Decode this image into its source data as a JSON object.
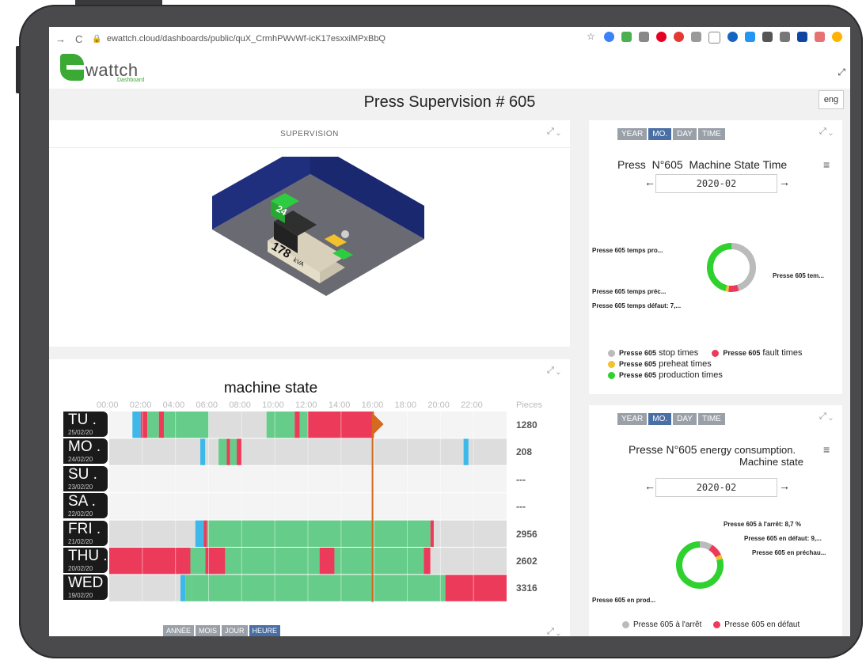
{
  "browser": {
    "url": "ewattch.cloud/dashboards/public/quX_CrmhPWvWf-icK17esxxiMPxBbQ"
  },
  "app": {
    "logo_text": "wattch",
    "logo_sub": "Dashboard",
    "page_title": "Press Supervision # 605",
    "lang": "eng"
  },
  "supervision": {
    "header": "SUPERVISION",
    "machine_number": "24",
    "machine_power": "178",
    "machine_unit": "kVA"
  },
  "machine_state": {
    "title": "machine state",
    "hours": [
      "00:00",
      "02:00",
      "04:00",
      "06:00",
      "08:00",
      "10:00",
      "12:00",
      "14:00",
      "16:00",
      "18:00",
      "20:00",
      "22:00"
    ],
    "pieces_header": "Pieces",
    "days": [
      {
        "day": "TU",
        "date": "25/02/20",
        "pieces": "1280"
      },
      {
        "day": "MO",
        "date": "24/02/20",
        "pieces": "208"
      },
      {
        "day": "SU",
        "date": "23/02/20",
        "pieces": "---"
      },
      {
        "day": "SA",
        "date": "22/02/20",
        "pieces": "---"
      },
      {
        "day": "FRI",
        "date": "21/02/20",
        "pieces": "2956"
      },
      {
        "day": "THU",
        "date": "20/02/20",
        "pieces": "2602"
      },
      {
        "day": "WED",
        "date": "19/02/20",
        "pieces": "3316"
      }
    ],
    "colors": {
      "production": "#66cc8a",
      "fault": "#ec3b5a",
      "preheat": "#3db8e8",
      "stop": "#dddddd",
      "empty": "#f4f4f4",
      "marker": "#d4691f"
    },
    "segments": [
      [
        [
          0,
          1.4,
          "empty"
        ],
        [
          1.4,
          1.9,
          "preheat"
        ],
        [
          1.9,
          2.3,
          "fault"
        ],
        [
          2.3,
          3.0,
          "production"
        ],
        [
          3.0,
          3.3,
          "fault"
        ],
        [
          3.3,
          6.0,
          "production"
        ],
        [
          6.0,
          9.5,
          "stop"
        ],
        [
          9.5,
          11.2,
          "production"
        ],
        [
          11.2,
          11.5,
          "fault"
        ],
        [
          11.5,
          12.0,
          "production"
        ],
        [
          12.0,
          16.0,
          "fault"
        ],
        [
          16.0,
          24,
          "empty"
        ]
      ],
      [
        [
          0,
          5.5,
          "stop"
        ],
        [
          5.5,
          5.8,
          "preheat"
        ],
        [
          5.8,
          6.6,
          "stop"
        ],
        [
          6.6,
          7.1,
          "production"
        ],
        [
          7.1,
          7.3,
          "fault"
        ],
        [
          7.3,
          7.7,
          "production"
        ],
        [
          7.7,
          8.0,
          "fault"
        ],
        [
          8.0,
          21.4,
          "stop"
        ],
        [
          21.4,
          21.7,
          "preheat"
        ],
        [
          21.7,
          24,
          "stop"
        ]
      ],
      [
        [
          0,
          24,
          "empty"
        ]
      ],
      [
        [
          0,
          24,
          "empty"
        ]
      ],
      [
        [
          0,
          5.2,
          "stop"
        ],
        [
          5.2,
          5.7,
          "preheat"
        ],
        [
          5.7,
          5.9,
          "fault"
        ],
        [
          5.9,
          19.4,
          "production"
        ],
        [
          19.4,
          19.6,
          "fault"
        ],
        [
          19.6,
          24,
          "stop"
        ]
      ],
      [
        [
          0,
          4.9,
          "fault"
        ],
        [
          4.9,
          5.8,
          "production"
        ],
        [
          5.8,
          7.0,
          "fault"
        ],
        [
          7.0,
          12.7,
          "production"
        ],
        [
          12.7,
          13.6,
          "fault"
        ],
        [
          13.6,
          19.0,
          "production"
        ],
        [
          19.0,
          19.4,
          "fault"
        ],
        [
          19.4,
          24,
          "stop"
        ]
      ],
      [
        [
          0,
          4.3,
          "stop"
        ],
        [
          4.3,
          4.6,
          "preheat"
        ],
        [
          4.6,
          5.0,
          "production"
        ],
        [
          5.0,
          20.3,
          "production"
        ],
        [
          20.3,
          24,
          "fault"
        ]
      ]
    ],
    "current_time": 15.9,
    "bottom_tabs": [
      {
        "label": "ANNÉE",
        "active": false
      },
      {
        "label": "MOIS",
        "active": false
      },
      {
        "label": "JOUR",
        "active": false
      },
      {
        "label": "HEURE",
        "active": true
      }
    ]
  },
  "period_tabs": [
    {
      "label": "YEAR",
      "active": false
    },
    {
      "label": "MO.",
      "active": true
    },
    {
      "label": "DAY",
      "active": false
    },
    {
      "label": "TIME",
      "active": false
    }
  ],
  "state_time_chart": {
    "title_prefix": "Press",
    "title_num": "N°605",
    "title_main": "Machine State Time",
    "period": "2020-02",
    "labels": {
      "production": "Presse 605 temps pro...",
      "stop": "Presse 605 tem...",
      "preheat": "Presse 605 temps préc...",
      "fault": "Presse 605 temps défaut: 7,..."
    },
    "legend": [
      {
        "name": "stop times",
        "prefix": "Presse 605",
        "color": "#bbbbbb"
      },
      {
        "name": "fault times",
        "prefix": "Presse 605",
        "color": "#ec3b5a"
      },
      {
        "name": "preheat times",
        "prefix": "Presse 605",
        "color": "#f2c12e"
      },
      {
        "name": "production times",
        "prefix": "Presse 605",
        "color": "#2ed12e"
      }
    ],
    "slices": [
      {
        "name": "stop",
        "value": 45,
        "color": "#bbbbbb"
      },
      {
        "name": "fault",
        "value": 7,
        "color": "#ec3b5a"
      },
      {
        "name": "preheat",
        "value": 2,
        "color": "#f2c12e"
      },
      {
        "name": "production",
        "value": 46,
        "color": "#2ed12e"
      }
    ]
  },
  "energy_chart": {
    "title_prefix": "Presse N°605",
    "title_main": "energy consumption.",
    "title_sub": "Machine state",
    "period": "2020-02",
    "labels": {
      "stop": "Presse 605 à l'arrêt: 8,7 %",
      "fault": "Presse 605 en défaut: 9,...",
      "preheat": "Presse 605 en préchau...",
      "production": "Presse 605 en prod..."
    },
    "legend": [
      {
        "name": "Presse 605 à l'arrêt",
        "color": "#bbbbbb"
      },
      {
        "name": "Presse 605 en défaut",
        "color": "#ec3b5a"
      }
    ],
    "slices": [
      {
        "name": "stop",
        "value": 8.7,
        "color": "#bbbbbb"
      },
      {
        "name": "fault",
        "value": 9,
        "color": "#ec3b5a"
      },
      {
        "name": "preheat",
        "value": 3,
        "color": "#f2c12e"
      },
      {
        "name": "production",
        "value": 79.3,
        "color": "#2ed12e"
      }
    ]
  }
}
